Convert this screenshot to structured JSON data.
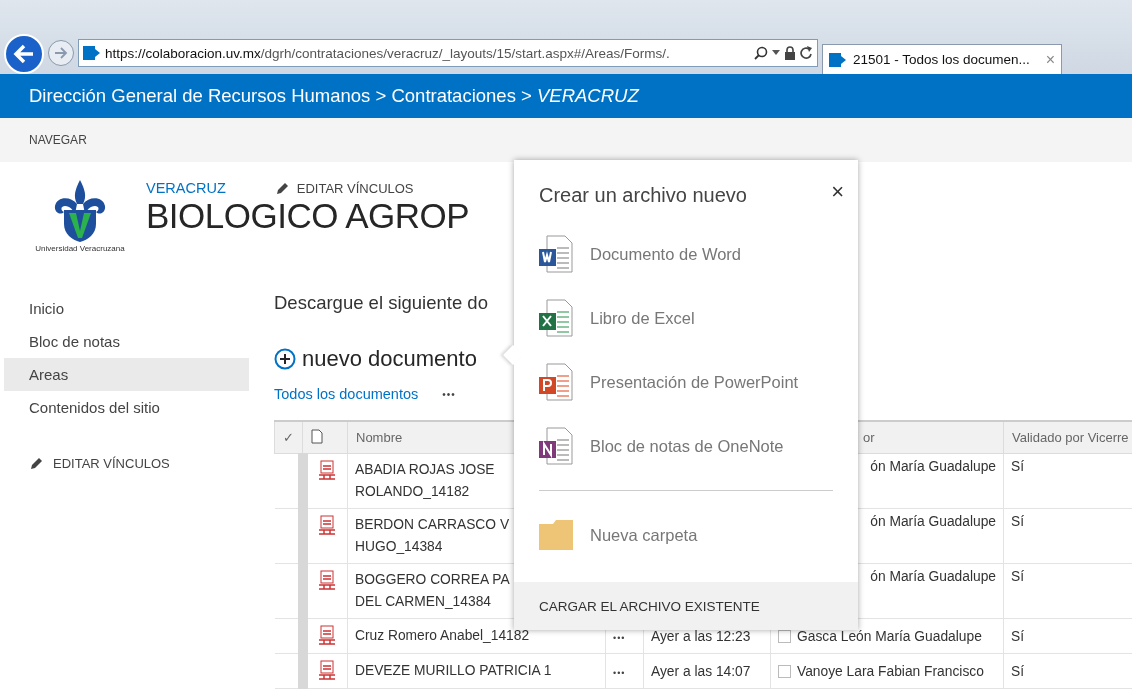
{
  "browser": {
    "url_host": "https://colaboracion.uv.mx",
    "url_path": "/dgrh/contrataciones/veracruz/_layouts/15/start.aspx#/Areas/Forms/.",
    "tab_title": "21501 - Todos los documen...",
    "tab_close": "×"
  },
  "suite_bar": {
    "breadcrumb": "Dirección General de Recursos Humanos > Contrataciones > *VERACRUZ*"
  },
  "nav_bar": {
    "label": "NAVEGAR"
  },
  "site": {
    "logo_caption": "Universidad Veracruzana",
    "parent_link": "VERACRUZ",
    "edit_links": "EDITAR VÍNCULOS",
    "title": "BIOLOGICO AGROP"
  },
  "sidebar": {
    "items": [
      {
        "label": "Inicio",
        "selected": false
      },
      {
        "label": "Bloc de notas",
        "selected": false
      },
      {
        "label": "Areas",
        "selected": true
      },
      {
        "label": "Contenidos del sitio",
        "selected": false
      }
    ],
    "edit_links": "EDITAR VÍNCULOS"
  },
  "content": {
    "intro": "Descargue el siguiente do",
    "new_document": "nuevo documento",
    "view": "Todos los documentos",
    "view_menu": "•••"
  },
  "table": {
    "header": {
      "select": "✓",
      "name": "Nombre",
      "person": "or",
      "validated": "Validado por Vicerre"
    },
    "rows": [
      {
        "kind": "covered",
        "name_lines": [
          "ABADIA ROJAS JOSE",
          "ROLANDO_14182"
        ],
        "person": "ón María Guadalupe",
        "validated": "Sí"
      },
      {
        "kind": "covered",
        "name_lines": [
          "BERDON CARRASCO V",
          "HUGO_14384"
        ],
        "person": "ón María Guadalupe",
        "validated": "Sí"
      },
      {
        "kind": "covered",
        "name_lines": [
          "BOGGERO CORREA PA",
          "DEL CARMEN_14384"
        ],
        "person": "ón María Guadalupe",
        "validated": "Sí"
      },
      {
        "kind": "full",
        "name_lines": [
          "Cruz Romero Anabel_14182"
        ],
        "menu": "•••",
        "modified": "Ayer a las 12:23",
        "checked": false,
        "person": "Gasca León María Guadalupe",
        "validated": "Sí"
      },
      {
        "kind": "full",
        "name_lines": [
          "DEVEZE MURILLO PATRICIA 1"
        ],
        "menu": "•••",
        "modified": "Ayer a las 14:07",
        "checked": false,
        "person": "Vanoye Lara Fabian Francisco",
        "validated": "Sí"
      }
    ]
  },
  "popup": {
    "title": "Crear un archivo nuevo",
    "close": "×",
    "items": [
      {
        "kind": "word",
        "label": "Documento de Word"
      },
      {
        "kind": "excel",
        "label": "Libro de Excel"
      },
      {
        "kind": "powerpoint",
        "label": "Presentación de PowerPoint"
      },
      {
        "kind": "onenote",
        "label": "Bloc de notas de OneNote"
      }
    ],
    "folder": {
      "kind": "folder",
      "label": "Nueva carpeta"
    },
    "footer": "CARGAR EL ARCHIVO EXISTENTE"
  }
}
